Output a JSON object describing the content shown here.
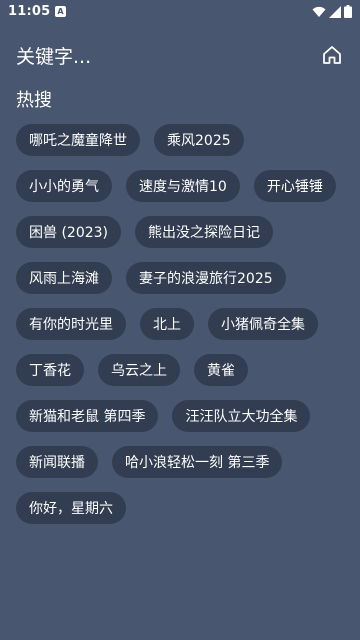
{
  "status_bar": {
    "time": "11:05",
    "app_badge": "A",
    "icons": [
      "wifi-icon",
      "signal-icon",
      "battery-icon"
    ]
  },
  "header": {
    "title": "关键字...",
    "home_icon": "home-icon"
  },
  "hot_search": {
    "title": "热搜",
    "tags": [
      "哪吒之魔童降世",
      "乘风2025",
      "小小的勇气",
      "速度与激情10",
      "开心锤锤",
      "困兽 (2023)",
      "熊出没之探险日记",
      "风雨上海滩",
      "妻子的浪漫旅行2025",
      "有你的时光里",
      "北上",
      "小猪佩奇全集",
      "丁香花",
      "乌云之上",
      "黄雀",
      "新猫和老鼠 第四季",
      "汪汪队立大功全集",
      "新闻联播",
      "哈小浪轻松一刻 第三季",
      "你好，星期六"
    ]
  },
  "colors": {
    "background": "#485670",
    "tag_background": "#323d52",
    "text": "#ffffff"
  }
}
